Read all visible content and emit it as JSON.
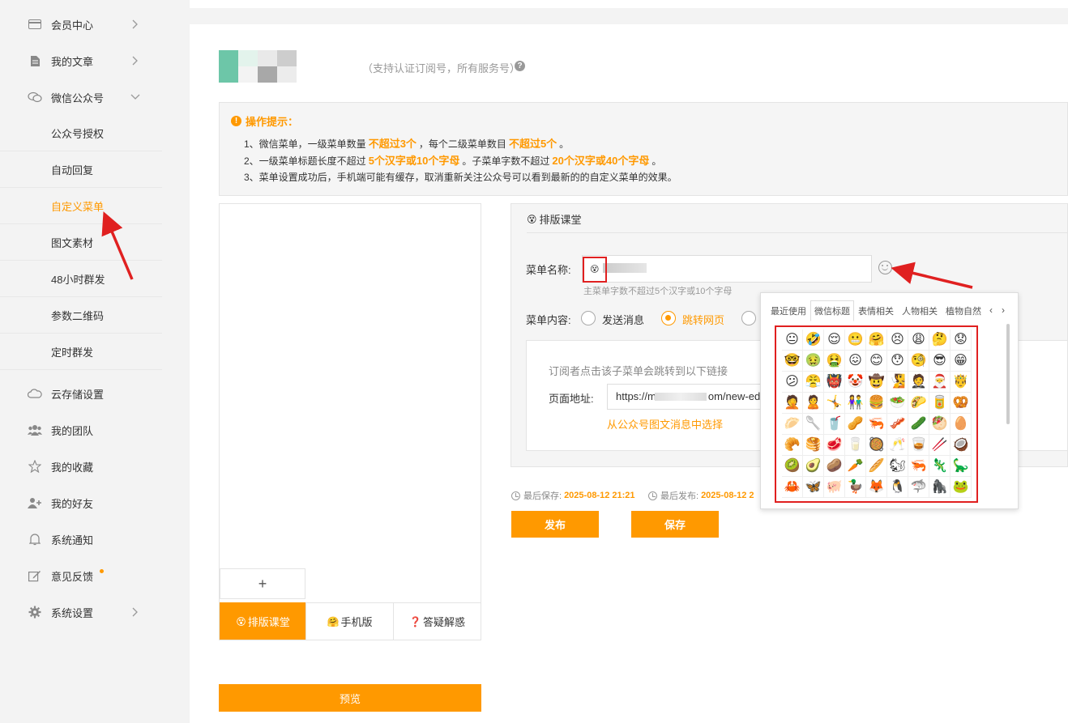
{
  "sidebar": {
    "items": [
      {
        "label": "会员中心",
        "icon": "card-icon"
      },
      {
        "label": "我的文章",
        "icon": "document-icon"
      },
      {
        "label": "微信公众号",
        "icon": "chat-icon"
      },
      {
        "label": "云存储设置",
        "icon": "cloud-icon"
      },
      {
        "label": "我的团队",
        "icon": "team-icon"
      },
      {
        "label": "我的收藏",
        "icon": "star-icon"
      },
      {
        "label": "我的好友",
        "icon": "add-friend-icon"
      },
      {
        "label": "系统通知",
        "icon": "bell-icon"
      },
      {
        "label": "意见反馈",
        "icon": "edit-icon"
      },
      {
        "label": "系统设置",
        "icon": "gear-icon"
      }
    ],
    "wechat_sub": [
      {
        "label": "公众号授权"
      },
      {
        "label": "自动回复"
      },
      {
        "label": "自定义菜单",
        "active": true
      },
      {
        "label": "图文素材"
      },
      {
        "label": "48小时群发"
      },
      {
        "label": "参数二维码"
      },
      {
        "label": "定时群发"
      }
    ]
  },
  "header": {
    "support_text": "（支持认证订阅号，所有服务号）",
    "help_glyph": "?"
  },
  "tips": {
    "title": "操作提示：",
    "line1": {
      "a": "1、微信菜单，一级菜单数量",
      "b": "不超过3个",
      "c": "，每个二级菜单数目",
      "d": "不超过5个",
      "e": "。"
    },
    "line2": {
      "a": "2、一级菜单标题长度不超过",
      "b": "5个汉字或10个字母",
      "c": "。子菜单字数不超过",
      "d": "20个汉字或40个字母",
      "e": "。"
    },
    "line3": "3、菜单设置成功后，手机端可能有缓存，取消重新关注公众号可以看到最新的的自定义菜单的效果。"
  },
  "phone": {
    "plus": "+",
    "tabs": [
      {
        "emoji": "😵",
        "label": "排版课堂",
        "active": true
      },
      {
        "emoji": "🤗",
        "label": "手机版"
      },
      {
        "emoji": "❓",
        "label": "答疑解惑"
      }
    ],
    "preview_label": "预览"
  },
  "editor": {
    "title_emoji": "😵",
    "title": "排版课堂",
    "name_label": "菜单名称:",
    "name_emoji": "😵",
    "name_hint": "主菜单字数不超过5个汉字或10个字母",
    "content_label": "菜单内容:",
    "radio_send": "发送消息",
    "radio_link": "跳转网页",
    "link_desc": "订阅者点击该子菜单会跳转到以下链接",
    "url_label": "页面地址:",
    "url_prefix": "https://m",
    "url_suffix": "om/new-ed",
    "pick_link": "从公众号图文消息中选择",
    "last_save_label": "最后保存:",
    "last_save_time": "2025-08-12 21:21",
    "last_publish_label": "最后发布:",
    "last_publish_time": "2025-08-12 2",
    "publish_btn": "发布",
    "save_btn": "保存"
  },
  "emoji_popup": {
    "tabs": [
      "最近使用",
      "微信标题",
      "表情相关",
      "人物相关",
      "植物自然"
    ],
    "active_tab": 1,
    "prev": "‹",
    "next": "›",
    "emojis": [
      "😐",
      "🤣",
      "😌",
      "😬",
      "🤗",
      "😣",
      "😩",
      "🤔",
      "😟",
      "🤓",
      "🤢",
      "🤮",
      "😖",
      "😊",
      "😯",
      "🧐",
      "😎",
      "😁",
      "😕",
      "😤",
      "👹",
      "🤡",
      "🤠",
      "🧏",
      "🤵",
      "🎅",
      "🤴",
      "🤦",
      "🙎",
      "🤸",
      "👫",
      "🍔",
      "🥗",
      "🌮",
      "🥫",
      "🥨",
      "🥟",
      "🥄",
      "🥤",
      "🥜",
      "🦐",
      "🥓",
      "🥒",
      "🥙",
      "🥚",
      "🥐",
      "🥞",
      "🥩",
      "🥛",
      "🥘",
      "🥂",
      "🥃",
      "🥢",
      "🥥",
      "🥝",
      "🥑",
      "🥔",
      "🥕",
      "🥖",
      "🐿",
      "🦐",
      "🦎",
      "🦕",
      "🦀",
      "🦋",
      "🐖",
      "🦆",
      "🦊",
      "🐧",
      "🦈",
      "🦍",
      "🐸"
    ]
  },
  "colors": {
    "accent": "#ff9900",
    "highlight": "#e02020"
  }
}
